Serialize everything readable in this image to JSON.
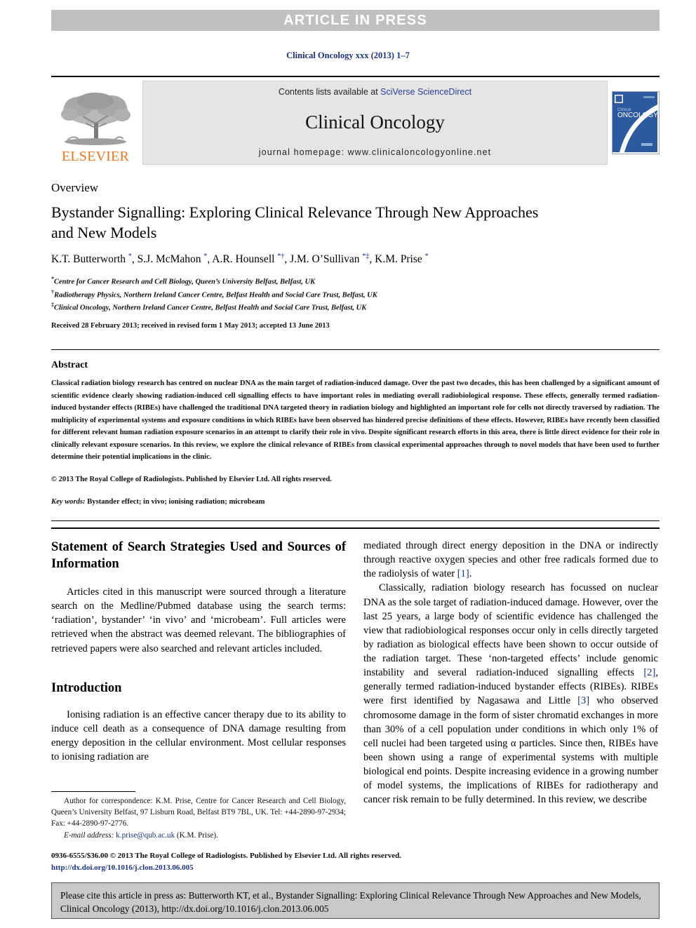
{
  "banner": {
    "label": "ARTICLE IN PRESS"
  },
  "running_head": "Clinical Oncology xxx (2013) 1–7",
  "masthead": {
    "publisher": "ELSEVIER",
    "contents_prefix": "Contents lists available at ",
    "contents_link": "SciVerse ScienceDirect",
    "journal_title": "Clinical Oncology",
    "homepage": "journal homepage: www.clinicaloncologyonline.net",
    "cover_line1": "Clinical",
    "cover_line2": "ONCOLOGY"
  },
  "article": {
    "kicker": "Overview",
    "title": "Bystander Signalling: Exploring Clinical Relevance Through New Approaches and New Models",
    "authors_html": "K.T. Butterworth <sup>*</sup>, S.J. McMahon <sup>*</sup>, A.R. Hounsell <sup>*†</sup>, J.M. O’Sullivan <sup>*‡</sup>, K.M. Prise <sup>*</sup>",
    "affiliations": [
      {
        "mark": "*",
        "text": "Centre for Cancer Research and Cell Biology, Queen’s University Belfast, Belfast, UK"
      },
      {
        "mark": "†",
        "text": "Radiotherapy Physics, Northern Ireland Cancer Centre, Belfast Health and Social Care Trust, Belfast, UK"
      },
      {
        "mark": "‡",
        "text": "Clinical Oncology, Northern Ireland Cancer Centre, Belfast Health and Social Care Trust, Belfast, UK"
      }
    ],
    "history": "Received 28 February 2013; received in revised form 1 May 2013; accepted 13 June 2013"
  },
  "abstract": {
    "heading": "Abstract",
    "body": "Classical radiation biology research has centred on nuclear DNA as the main target of radiation-induced damage. Over the past two decades, this has been challenged by a significant amount of scientific evidence clearly showing radiation-induced cell signalling effects to have important roles in mediating overall radiobiological response. These effects, generally termed radiation-induced bystander effects (RIBEs) have challenged the traditional DNA targeted theory in radiation biology and highlighted an important role for cells not directly traversed by radiation. The multiplicity of experimental systems and exposure conditions in which RIBEs have been observed has hindered precise definitions of these effects. However, RIBEs have recently been classified for different relevant human radiation exposure scenarios in an attempt to clarify their role in vivo. Despite significant research efforts in this area, there is little direct evidence for their role in clinically relevant exposure scenarios. In this review, we explore the clinical relevance of RIBEs from classical experimental approaches through to novel models that have been used to further determine their potential implications in the clinic.",
    "copyright": "© 2013 The Royal College of Radiologists. Published by Elsevier Ltd. All rights reserved.",
    "keywords_label": "Key words:",
    "keywords_value": " Bystander effect; in vivo; ionising radiation; microbeam"
  },
  "body": {
    "left": {
      "heading1": "Statement of Search Strategies Used and Sources of Information",
      "para1": "Articles cited in this manuscript were sourced through a literature search on the Medline/Pubmed database using the search terms: ‘radiation’, bystander’ ‘in vivo’ and ‘microbeam’. Full articles were retrieved when the abstract was deemed relevant. The bibliographies of retrieved papers were also searched and relevant articles included.",
      "heading2": "Introduction",
      "para2": "Ionising radiation is an effective cancer therapy due to its ability to induce cell death as a consequence of DNA damage resulting from energy deposition in the cellular environment. Most cellular responses to ionising radiation are"
    },
    "right": {
      "para1_pre": "mediated through direct energy deposition in the DNA or indirectly through reactive oxygen species and other free radicals formed due to the radiolysis of water ",
      "ref1": "[1]",
      "para1_post": ".",
      "para2_a": "Classically, radiation biology research has focussed on nuclear DNA as the sole target of radiation-induced damage. However, over the last 25 years, a large body of scientific evidence has challenged the view that radiobiological responses occur only in cells directly targeted by radiation as biological effects have been shown to occur outside of the radiation target. These ‘non-targeted effects’ include genomic instability and several radiation-induced signalling effects ",
      "ref2": "[2]",
      "para2_b": ", generally termed radiation-induced bystander effects (RIBEs). RIBEs were first identified by Nagasawa and Little ",
      "ref3": "[3]",
      "para2_c": " who observed chromosome damage in the form of sister chromatid exchanges in more than 30% of a cell population under conditions in which only 1% of cell nuclei had been targeted using α particles. Since then, RIBEs have been shown using a range of experimental systems with multiple biological end points. Despite increasing evidence in a growing number of model systems, the implications of RIBEs for radiotherapy and cancer risk remain to be fully determined. In this review, we describe"
    }
  },
  "footnote": {
    "correspondence": "Author for correspondence: K.M. Prise, Centre for Cancer Research and Cell Biology, Queen’s University Belfast, 97 Lisburn Road, Belfast BT9 7BL, UK. Tel: +44-2890-97-2934; Fax: +44-2890-97-2776.",
    "email_label": "E-mail address:",
    "email": "k.prise@qub.ac.uk",
    "email_suffix": " (K.M. Prise)."
  },
  "copyright_block": {
    "line1": "0936-6555/$36.00 © 2013 The Royal College of Radiologists. Published by Elsevier Ltd. All rights reserved.",
    "doi": "http://dx.doi.org/10.1016/j.clon.2013.06.005"
  },
  "cite_box": {
    "text": "Please cite this article in press as: Butterworth KT, et al., Bystander Signalling: Exploring Clinical Relevance Through New Approaches and New Models, Clinical Oncology (2013), http://dx.doi.org/10.1016/j.clon.2013.06.005"
  },
  "colors": {
    "banner_bg": "#c0c0c0",
    "link_blue": "#1b3281",
    "elsevier_orange": "#e87722",
    "cover_blue": "#2d5a9e",
    "cite_box_bg": "#c9c9c9"
  }
}
